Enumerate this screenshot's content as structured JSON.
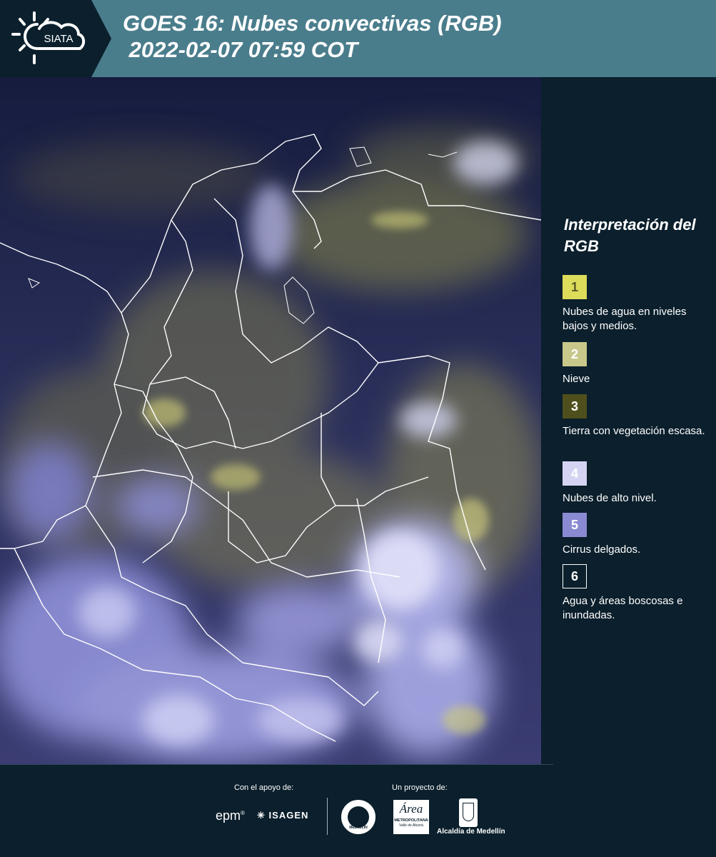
{
  "header": {
    "logo_text": "SIATA",
    "title_line1": "GOES 16: Nubes convectivas (RGB)",
    "title_line2": " 2022-02-07 07:59 COT"
  },
  "map": {
    "description_icon": "satellite-map-icon",
    "colors": {
      "background": "#1c2452",
      "cloud_high": "#b4b6f2",
      "cloud_low": "#bdbf6c",
      "border": "#ffffff"
    }
  },
  "legend": {
    "title": "Interpretación del RGB",
    "items": [
      {
        "num": "1",
        "label": "Nubes de agua en niveles bajos y medios.",
        "color": "#dcdc5a",
        "text_color": "#5a5a2a"
      },
      {
        "num": "2",
        "label": "Nieve",
        "color": "#c8c88a",
        "text_color": "#ffffff"
      },
      {
        "num": "3",
        "label": "Tierra con vegetación escasa.",
        "color": "#4f4f1d",
        "text_color": "#ffffff"
      },
      {
        "num": "4",
        "label": "Nubes de alto nivel.",
        "color": "#d4d4f2",
        "text_color": "#ffffff"
      },
      {
        "num": "5",
        "label": "Cirrus delgados.",
        "color": "#8a8ad2",
        "text_color": "#ffffff"
      },
      {
        "num": "6",
        "label": "Agua y áreas boscosas e inundadas.",
        "color": "#0b1f2c",
        "text_color": "#ffffff"
      }
    ]
  },
  "footer": {
    "support_label": "Con el apoyo de:",
    "project_label": "Un proyecto de:",
    "sponsor1": "epm",
    "sponsor2": "ISAGEN",
    "org1": "MEDELLÍN",
    "org2_name": "Área",
    "org2_sub1": "METROPOLITANA",
    "org2_sub2": "Valle de Aburrá",
    "org3": "Alcaldía de Medellín"
  }
}
